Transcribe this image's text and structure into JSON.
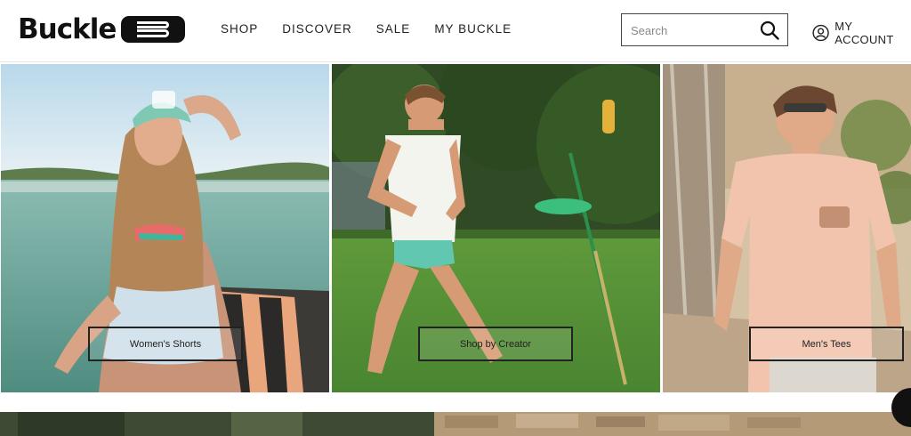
{
  "brand": {
    "name": "Buckle"
  },
  "nav": {
    "items": [
      {
        "label": "SHOP"
      },
      {
        "label": "DISCOVER"
      },
      {
        "label": "SALE"
      },
      {
        "label": "MY BUCKLE"
      }
    ]
  },
  "search": {
    "placeholder": "Search",
    "icon": "search-icon"
  },
  "account": {
    "label": "MY ACCOUNT",
    "icon": "user-circle-icon"
  },
  "tiles": [
    {
      "label": "Women's Shorts"
    },
    {
      "label": "Shop by Creator"
    },
    {
      "label": "Men's Tees"
    }
  ],
  "chat": {
    "icon": "chat-icon"
  }
}
